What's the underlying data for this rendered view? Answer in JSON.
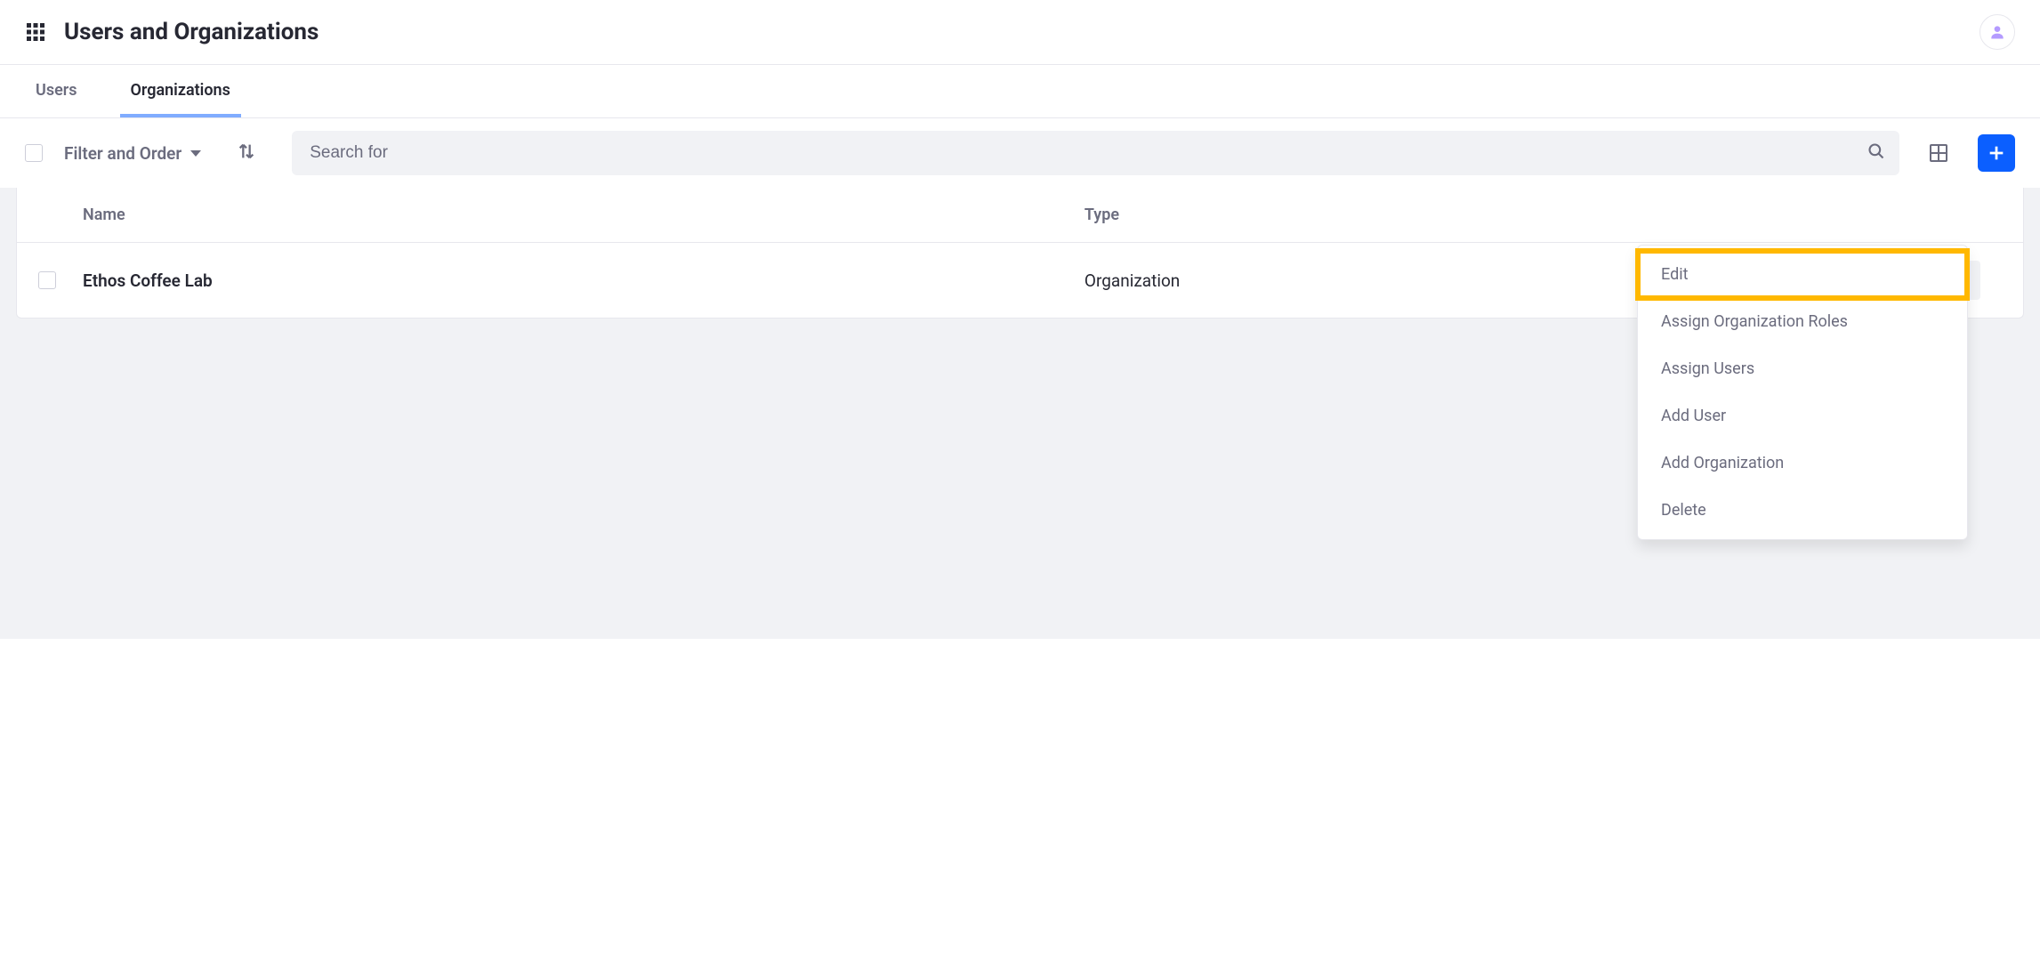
{
  "header": {
    "title": "Users and Organizations"
  },
  "tabs": {
    "users": "Users",
    "organizations": "Organizations"
  },
  "toolbar": {
    "filter_label": "Filter and Order",
    "search_placeholder": "Search for"
  },
  "table": {
    "columns": {
      "name": "Name",
      "type": "Type"
    },
    "rows": [
      {
        "name": "Ethos Coffee Lab",
        "type": "Organization"
      }
    ]
  },
  "dropdown": {
    "edit": "Edit",
    "assign_roles": "Assign Organization Roles",
    "assign_users": "Assign Users",
    "add_user": "Add User",
    "add_organization": "Add Organization",
    "delete": "Delete"
  }
}
